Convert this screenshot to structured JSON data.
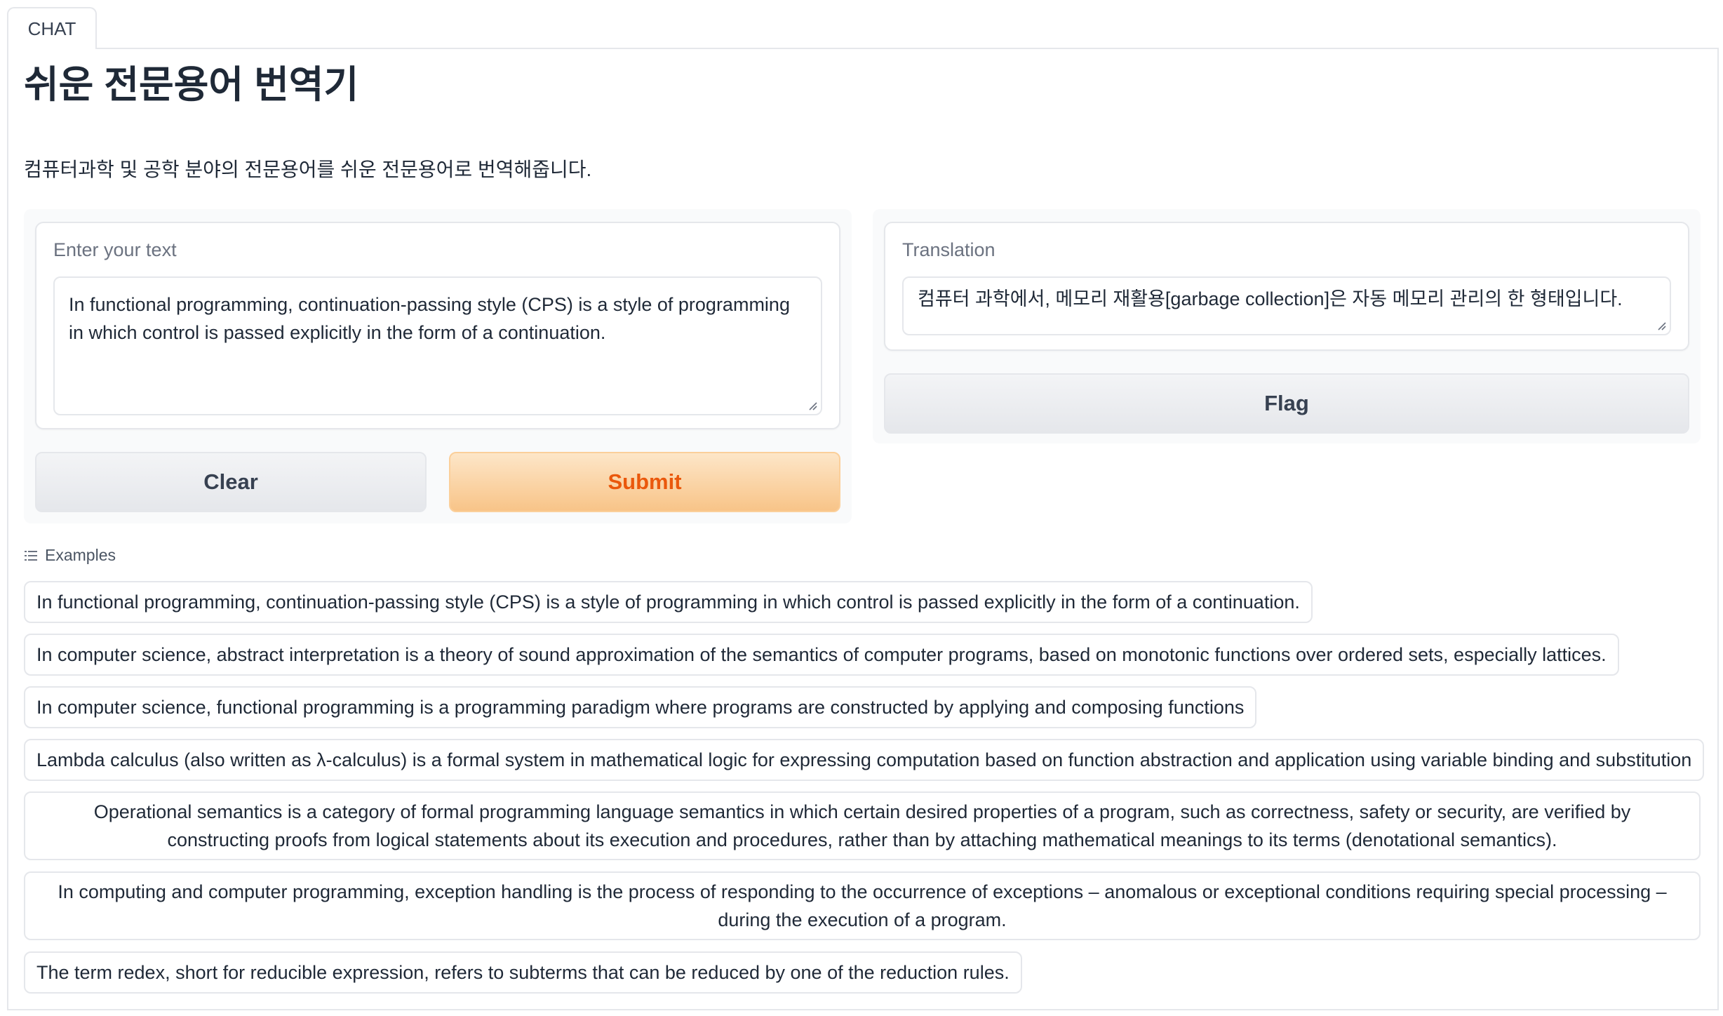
{
  "tab": {
    "label": "CHAT"
  },
  "header": {
    "title": "쉬운 전문용어 번역기",
    "description": "컴퓨터과학 및 공학 분야의 전문용어를 쉬운 전문용어로 번역해줍니다."
  },
  "input": {
    "label": "Enter your text",
    "value": "In functional programming, continuation-passing style (CPS) is a style of programming in which control is passed explicitly in the form of a continuation."
  },
  "output": {
    "label": "Translation",
    "value": "컴퓨터 과학에서, 메모리 재활용[garbage collection]은 자동 메모리 관리의 한 형태입니다."
  },
  "buttons": {
    "clear": "Clear",
    "submit": "Submit",
    "flag": "Flag"
  },
  "examples": {
    "label": "Examples",
    "items": [
      "In functional programming, continuation-passing style (CPS) is a style of programming in which control is passed explicitly in the form of a continuation.",
      "In computer science, abstract interpretation is a theory of sound approximation of the semantics of computer programs, based on monotonic functions over ordered sets, especially lattices.",
      "In computer science, functional programming is a programming paradigm where programs are constructed by applying and composing functions",
      "Lambda calculus (also written as λ-calculus) is a formal system in mathematical logic for expressing computation based on function abstraction and application using variable binding and substitution",
      "Operational semantics is a category of formal programming language semantics in which certain desired properties of a program, such as correctness, safety or security, are verified by constructing proofs from logical statements about its execution and procedures, rather than by attaching mathematical meanings to its terms (denotational semantics).",
      "In computing and computer programming, exception handling is the process of responding to the occurrence of exceptions – anomalous or exceptional conditions requiring special processing – during the execution of a program.",
      "The term redex, short for reducible expression, refers to subterms that can be reduced by one of the reduction rules."
    ]
  },
  "icons": {
    "examples": "list-icon",
    "resize": "resize-handle-icon"
  },
  "colors": {
    "accent": "#ea580c",
    "primary_bg": "#f8c488"
  }
}
